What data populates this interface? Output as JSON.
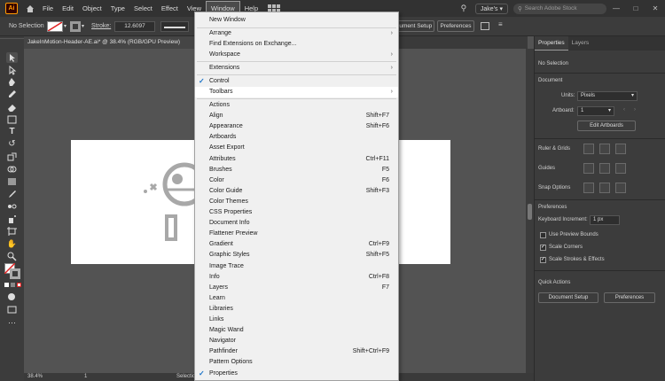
{
  "menubar": {
    "logo": "Ai",
    "items": [
      "File",
      "Edit",
      "Object",
      "Type",
      "Select",
      "Effect",
      "View",
      "Window",
      "Help"
    ],
    "account": "Jake's",
    "search_placeholder": "Search Adobe Stock"
  },
  "controlbar": {
    "selection": "No Selection",
    "stroke_label": "Stroke:",
    "stroke_value": "12.6097",
    "document_setup": "Document Setup",
    "preferences": "Preferences"
  },
  "document": {
    "tab_title": "JakeInMotion-Header-AE.ai* @ 38.4% (RGB/GPU Preview)",
    "zoom": "38.4%",
    "page": "1",
    "status": "Selection"
  },
  "panel": {
    "tabs": [
      "Properties",
      "Layers"
    ],
    "selection": "No Selection",
    "document_heading": "Document",
    "units_label": "Units:",
    "units_value": "Pixels",
    "artboard_label": "Artboard:",
    "artboard_value": "1",
    "edit_artboards": "Edit Artboards",
    "rulers_grids": "Ruler & Grids",
    "guides": "Guides",
    "snap_options": "Snap Options",
    "preferences_heading": "Preferences",
    "keyboard_increment_label": "Keyboard Increment:",
    "keyboard_increment_value": "1 px",
    "use_preview_bounds": "Use Preview Bounds",
    "scale_corners": "Scale Corners",
    "scale_strokes": "Scale Strokes & Effects",
    "quick_actions": "Quick Actions",
    "document_setup": "Document Setup",
    "preferences": "Preferences"
  },
  "window_menu": {
    "new_window": "New Window",
    "arrange": "Arrange",
    "find_extensions": "Find Extensions on Exchange...",
    "workspace": "Workspace",
    "extensions": "Extensions",
    "control": "Control",
    "toolbars": "Toolbars",
    "items": [
      {
        "label": "Actions",
        "shortcut": ""
      },
      {
        "label": "Align",
        "shortcut": "Shift+F7"
      },
      {
        "label": "Appearance",
        "shortcut": "Shift+F6"
      },
      {
        "label": "Artboards",
        "shortcut": ""
      },
      {
        "label": "Asset Export",
        "shortcut": ""
      },
      {
        "label": "Attributes",
        "shortcut": "Ctrl+F11"
      },
      {
        "label": "Brushes",
        "shortcut": "F5"
      },
      {
        "label": "Color",
        "shortcut": "F6"
      },
      {
        "label": "Color Guide",
        "shortcut": "Shift+F3"
      },
      {
        "label": "Color Themes",
        "shortcut": ""
      },
      {
        "label": "CSS Properties",
        "shortcut": ""
      },
      {
        "label": "Document Info",
        "shortcut": ""
      },
      {
        "label": "Flattener Preview",
        "shortcut": ""
      },
      {
        "label": "Gradient",
        "shortcut": "Ctrl+F9"
      },
      {
        "label": "Graphic Styles",
        "shortcut": "Shift+F5"
      },
      {
        "label": "Image Trace",
        "shortcut": ""
      },
      {
        "label": "Info",
        "shortcut": "Ctrl+F8"
      },
      {
        "label": "Layers",
        "shortcut": "F7"
      },
      {
        "label": "Learn",
        "shortcut": ""
      },
      {
        "label": "Libraries",
        "shortcut": ""
      },
      {
        "label": "Links",
        "shortcut": ""
      },
      {
        "label": "Magic Wand",
        "shortcut": ""
      },
      {
        "label": "Navigator",
        "shortcut": ""
      },
      {
        "label": "Pathfinder",
        "shortcut": "Shift+Ctrl+F9"
      },
      {
        "label": "Pattern Options",
        "shortcut": ""
      },
      {
        "label": "Properties",
        "shortcut": ""
      }
    ]
  },
  "colors": {
    "menubar_bg": "#323232",
    "panel_bg": "#3c3c3c",
    "canvas_bg": "#535353",
    "menu_bg": "#f0f0f0",
    "check": "#1a73c8",
    "logo": "#ff9a00"
  }
}
